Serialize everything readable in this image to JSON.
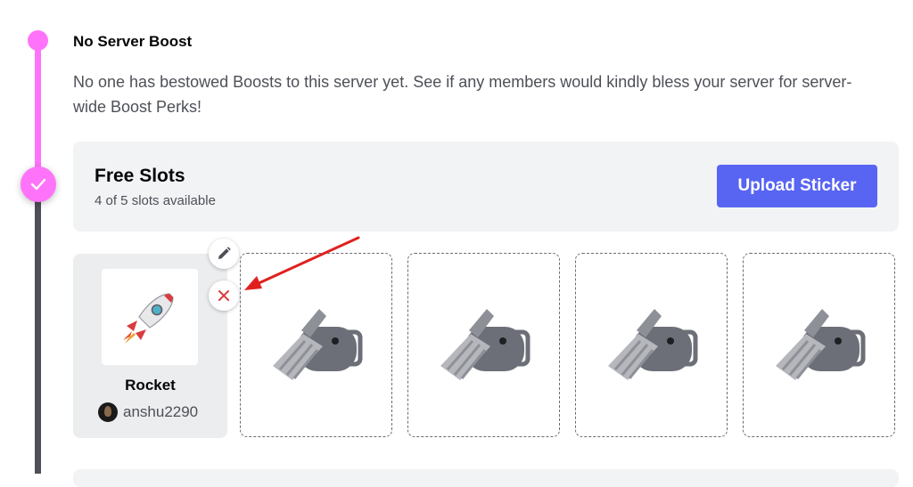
{
  "tier": {
    "title": "No Server Boost",
    "description": "No one has bestowed Boosts to this server yet. See if any members would kindly bless your server for server-wide Boost Perks!"
  },
  "slots": {
    "title": "Free Slots",
    "subtitle": "4 of 5 slots available",
    "upload_label": "Upload Sticker"
  },
  "sticker": {
    "name": "Rocket",
    "owner": "anshu2290",
    "icon": "rocket-icon"
  },
  "empty_slot_icon": "sticker-placeholder-icon",
  "colors": {
    "accent": "#5865f2",
    "timeline_pink": "#ff73fa",
    "timeline_dark": "#4e5058",
    "remove_red": "#d83c3e",
    "annotation_arrow": "#e0201e"
  }
}
